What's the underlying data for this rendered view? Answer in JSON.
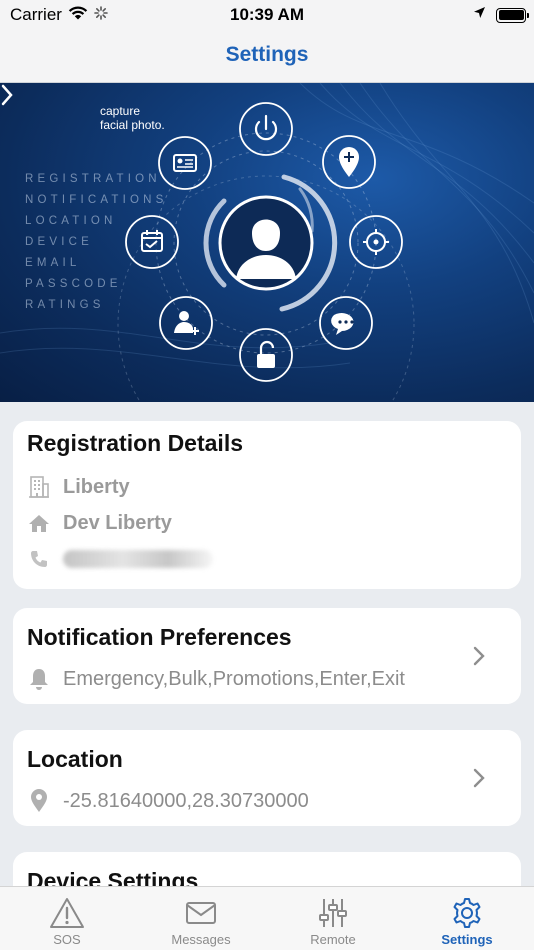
{
  "status_bar": {
    "carrier": "Carrier",
    "time": "10:39 AM"
  },
  "nav": {
    "title": "Settings"
  },
  "banner": {
    "caption_line1": "capture",
    "caption_line2": "facial photo.",
    "menu_items": [
      "REGISTRATION",
      "NOTIFICATIONS",
      "LOCATION",
      "DEVICE",
      "EMAIL",
      "PASSCODE",
      "RATINGS"
    ]
  },
  "registration": {
    "title": "Registration Details",
    "company": "Liberty",
    "site": "Dev Liberty"
  },
  "notifications": {
    "title": "Notification Preferences",
    "value": "Emergency,Bulk,Promotions,Enter,Exit"
  },
  "location": {
    "title": "Location",
    "value": "-25.81640000,28.30730000"
  },
  "device": {
    "title": "Device Settings"
  },
  "tabs": [
    {
      "label": "SOS",
      "icon": "warning-icon"
    },
    {
      "label": "Messages",
      "icon": "envelope-icon"
    },
    {
      "label": "Remote",
      "icon": "sliders-icon"
    },
    {
      "label": "Settings",
      "icon": "gear-icon"
    }
  ],
  "colors": {
    "accent": "#1f63b8",
    "banner": "#0c2c5c",
    "background": "#e9ecf0"
  }
}
